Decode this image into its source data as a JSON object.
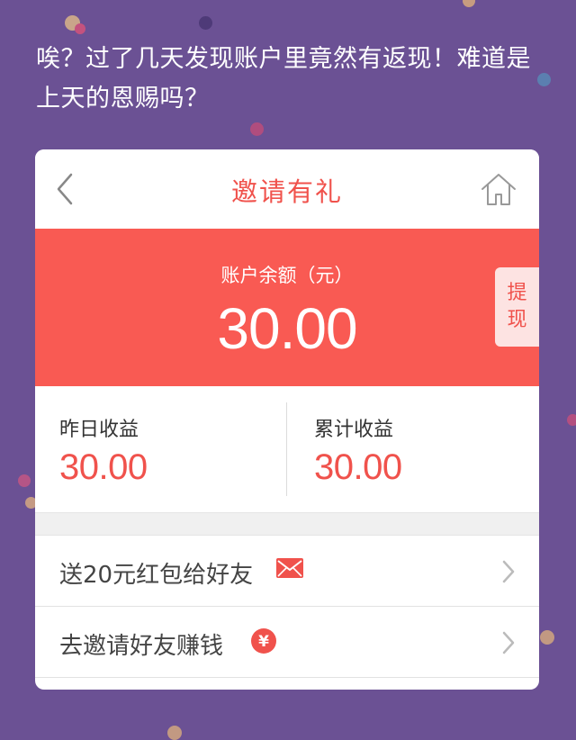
{
  "caption": {
    "text": "唉？过了几天发现账户里竟然有返现！难道是上天的恩赐吗？"
  },
  "navbar": {
    "title": "邀请有礼",
    "back_icon": "chevron-left-icon",
    "home_icon": "home-icon"
  },
  "balance": {
    "label": "账户余额（元）",
    "value": "30.00",
    "withdraw_label": "提现"
  },
  "stats": {
    "yesterday_label": "昨日收益",
    "yesterday_value": "30.00",
    "total_label": "累计收益",
    "total_value": "30.00"
  },
  "actions": [
    {
      "label": "送20元红包给好友",
      "icon": "envelope-icon"
    },
    {
      "label": "去邀请好友赚钱",
      "icon": "yuan-coin-icon"
    }
  ],
  "colors": {
    "background": "#6b5194",
    "accent": "#f95a53",
    "accent_text": "#f0524c",
    "withdraw_bg": "#fde3e2"
  }
}
